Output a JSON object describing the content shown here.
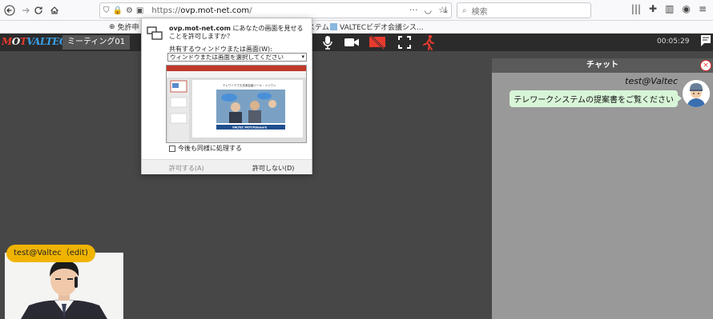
{
  "browser": {
    "url_host": "ovp.mot-net.com",
    "url_prefix": "https://",
    "url_suffix": "/",
    "search_placeholder": "検索",
    "bookmarks": [
      {
        "label": "免許申"
      },
      {
        "label": "ステム"
      },
      {
        "label": "VALTECビデオ会議シス..."
      }
    ]
  },
  "app": {
    "logo_m": "M",
    "logo_o": "O",
    "logo_t": "T",
    "logo_v": "VALTEC",
    "room_name": "ミーティング01",
    "timer": "00:05:29"
  },
  "self_video": {
    "name_badge": "test@Valtec（edit)"
  },
  "chat": {
    "title": "チャット",
    "close": "×",
    "sender": "test@Valtec",
    "message": "テレワークシステムの提案書をご覧ください"
  },
  "share_dialog": {
    "site": "ovp.mot-net.com",
    "message": " にあなたの画面を見せることを許可しますか？",
    "select_label": "共有するウィンドウまたは画面(W):",
    "select_value": "ウィンドウまたは画面を選択してください",
    "remember_label": "今後も同様に処理する",
    "allow_label": "許可する(A)",
    "deny_label": "許可しない(D)",
    "preview_title": "テレワークでも充実会議ツール・インワン",
    "preview_brand": "VALTEC MOT/Telework"
  },
  "colors": {
    "header_bg": "#2b2b2b",
    "main_bg": "#474747",
    "chat_bg": "#999999",
    "badge": "#f0b400",
    "bubble": "#d8f5d8",
    "exit_red": "#e63a2e"
  }
}
